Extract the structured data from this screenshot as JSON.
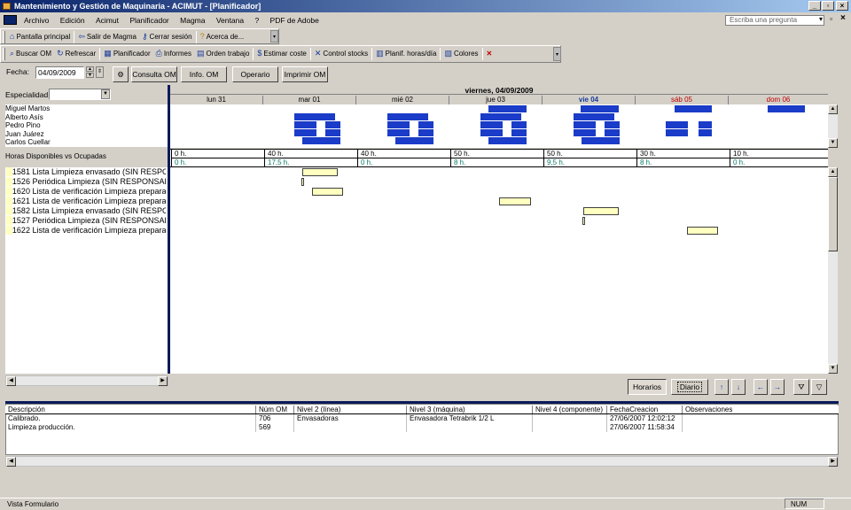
{
  "window": {
    "title": "Mantenimiento y Gestión de Maquinaria - ACIMUT - [Planificador]"
  },
  "menu": {
    "items": [
      "Archivo",
      "Edición",
      "Acimut",
      "Planificador",
      "Magma",
      "Ventana",
      "?",
      "PDF de Adobe"
    ],
    "ask_placeholder": "Escriba una pregunta"
  },
  "toolbar1": [
    "Pantalla principal",
    "Salir de Magma",
    "Cerrar sesión",
    "Acerca de..."
  ],
  "toolbar2": [
    "Buscar OM",
    "Refrescar",
    "Planificador",
    "Informes",
    "Orden trabajo",
    "Estimar coste",
    "Control stocks",
    "Planif. horas/día",
    "Colores"
  ],
  "filters": {
    "fecha_label": "Fecha:",
    "fecha_value": "04/09/2009",
    "buttons": [
      "Consulta OM",
      "Info. OM",
      "Operario",
      "Imprimir OM"
    ],
    "especialidad_label": "Especialidad:"
  },
  "schedule": {
    "header_date": "viernes, 04/09/2009",
    "days": [
      "lun 31",
      "mar 01",
      "mié 02",
      "jue 03",
      "vie 04",
      "sáb 05",
      "dom 06"
    ],
    "operators": [
      "Miguel Martos",
      "Alberto Asís",
      "Pedro Pino",
      "Juan Juárez",
      "Carlos Cuellar"
    ],
    "hours_label": "Horas Disponibles vs Ocupadas",
    "available_hours": [
      "0 h.",
      "40 h.",
      "40 h.",
      "50 h.",
      "50 h.",
      "30 h.",
      "10 h."
    ],
    "occupied_hours": [
      "0 h.",
      "17,5 h.",
      "0 h.",
      "8 h.",
      "9,5 h.",
      "8 h.",
      "0 h."
    ],
    "tasks": [
      "1581 Lista Limpieza envasado  (SIN RESPONSABLE)",
      "1526 Periódica Limpieza  (SIN RESPONSABLE)",
      "1620 Lista de verificación Limpieza preparación",
      "1621 Lista de verificación Limpieza preparación",
      "1582 Lista Limpieza envasado  (SIN RESPONSABLE)",
      "1527 Periódica Limpieza  (SIN RESPONSABLE)",
      "1622 Lista de verificación Limpieza preparación"
    ]
  },
  "view_buttons": {
    "horarios": "Horarios",
    "diario": "Diario"
  },
  "table": {
    "columns": [
      "Descripción",
      "Núm OM",
      "Nivel 2 (línea)",
      "Nivel 3 (máquina)",
      "Nivel 4 (componente)",
      "FechaCreacion",
      "Observaciones"
    ],
    "rows": [
      [
        "Calibrado.",
        "706",
        "Envasadoras",
        "Envasadora Tetrabrik 1/2 L",
        "",
        "27/06/2007 12:02:12",
        ""
      ],
      [
        "Limpieza producción.",
        "569",
        "",
        "",
        "",
        "27/06/2007 11:58:34",
        ""
      ]
    ]
  },
  "status": {
    "left": "Vista Formulario",
    "right": "NUM"
  },
  "colors": {
    "titlebar": "#0a246a",
    "block": "#1a3cc8",
    "task_bar": "#ffffc0",
    "weekend": "#c00000"
  }
}
